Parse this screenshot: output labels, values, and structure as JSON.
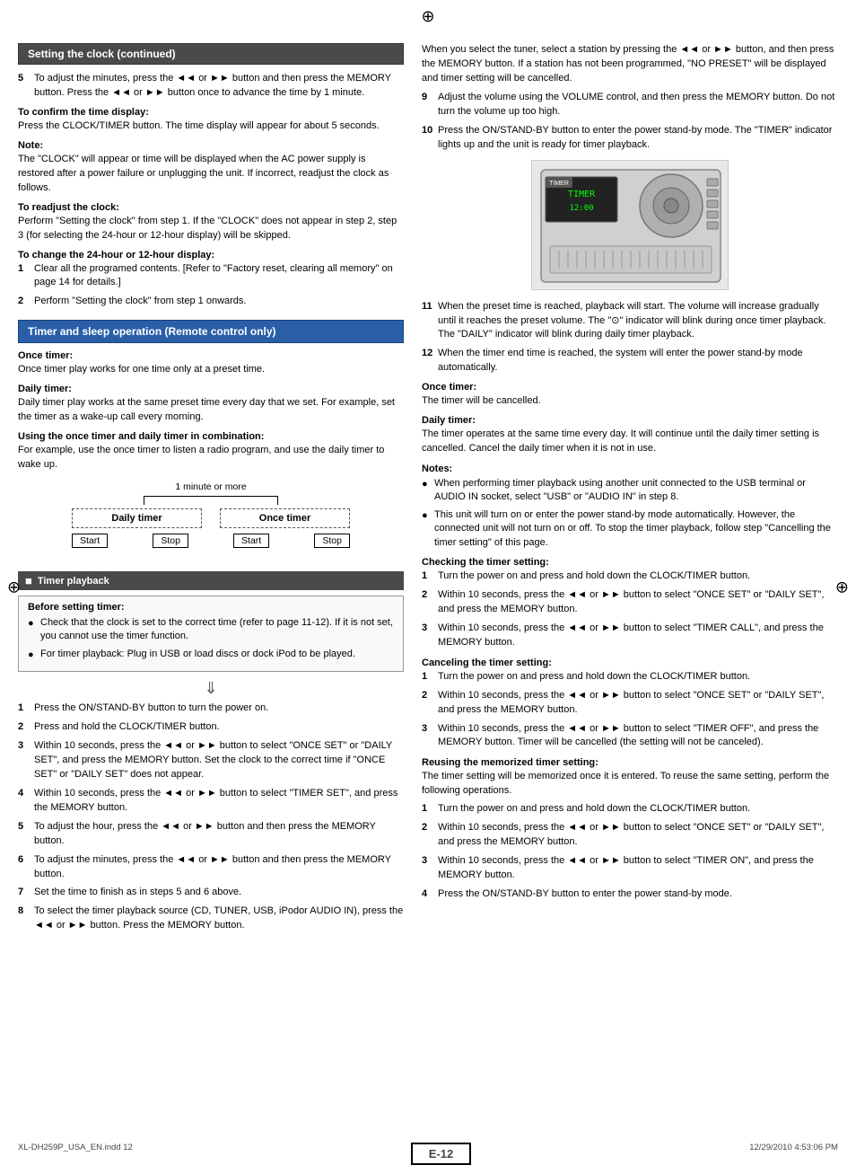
{
  "page": {
    "reg_mark": "⊕",
    "page_number": "E-12",
    "file_info": "XL-DH259P_USA_EN.indd   12",
    "date_info": "12/29/2010   4:53:06 PM"
  },
  "left_column": {
    "section1_title": "Setting the clock (continued)",
    "step5": "To adjust the minutes, press the ◄◄ or ►► button and then press the MEMORY button. Press the ◄◄ or ►► button once to advance the time by 1 minute.",
    "confirm_heading": "To confirm the time display:",
    "confirm_text": "Press the CLOCK/TIMER button. The time display will appear for about 5 seconds.",
    "note_heading": "Note:",
    "note_text": "The \"CLOCK\" will appear or time will be displayed when the AC power supply is restored after a power failure or unplugging the unit. If incorrect, readjust the clock as follows.",
    "readjust_heading": "To readjust the clock:",
    "readjust_text": "Perform \"Setting the clock\" from step 1. If the \"CLOCK\" does not appear in step 2, step 3 (for selecting the 24-hour or 12-hour display) will be skipped.",
    "change24_heading": "To change the 24-hour or 12-hour display:",
    "change24_step1": "Clear all the programed contents. [Refer to \"Factory reset, clearing all memory\" on page 14 for details.]",
    "change24_step2": "Perform \"Setting the clock\" from step 1 onwards.",
    "section2_title": "Timer and sleep operation (Remote control only)",
    "once_timer_heading": "Once timer:",
    "once_timer_text": "Once timer play works for one time only at a preset time.",
    "daily_timer_heading": "Daily timer:",
    "daily_timer_text": "Daily timer play works at the same preset time every day that we set. For example, set the timer as a wake-up call every morning.",
    "combo_heading": "Using the once timer and daily timer in combination:",
    "combo_text": "For example, use the once timer to listen a radio program, and use the daily timer to wake up.",
    "diagram_label_top": "1 minute or more",
    "diagram_daily": "Daily timer",
    "diagram_once": "Once timer",
    "diagram_start1": "Start",
    "diagram_stop1": "Stop",
    "diagram_start2": "Start",
    "diagram_stop2": "Stop",
    "timer_playback_title": "Timer playback",
    "before_title": "Before setting timer:",
    "before_bullet1": "Check that the clock is set to the correct time (refer to page 11-12). If it is not set, you cannot use the timer function.",
    "before_bullet2": "For timer playback: Plug in USB or load discs or dock iPod to be played.",
    "arrow": "⇓",
    "pb_step1": "Press the ON/STAND-BY button to turn the power on.",
    "pb_step2": "Press and hold the CLOCK/TIMER button.",
    "pb_step3": "Within 10 seconds, press the ◄◄ or ►► button to select \"ONCE SET\" or \"DAILY SET\", and press the MEMORY button. Set the clock to the correct time if \"ONCE SET\" or \"DAILY SET\" does not appear.",
    "pb_step4": "Within 10 seconds, press the ◄◄ or ►► button to select \"TIMER SET\", and press the MEMORY button.",
    "pb_step5": "To adjust the hour, press the ◄◄ or ►► button and then press the MEMORY button.",
    "pb_step6": "To adjust the minutes, press the ◄◄ or ►► button and then press the MEMORY button.",
    "pb_step7": "Set the time to finish as in steps 5 and 6 above.",
    "pb_step8": "To select the timer playback source (CD, TUNER, USB, iPodor AUDIO IN), press the ◄◄ or ►► button. Press the MEMORY button."
  },
  "right_column": {
    "step8_text": "When you select the tuner, select a station by pressing the ◄◄ or ►► button, and then press the MEMORY button. If a station has not been programmed, \"NO PRESET\" will be displayed and timer setting will be cancelled.",
    "step9": "Adjust the volume using the VOLUME control, and then press the MEMORY button. Do not turn the volume up too high.",
    "step10": "Press the ON/STAND-BY button to enter the power stand-by mode. The \"TIMER\" indicator lights up and the unit is ready for timer playback.",
    "step11": "When the preset time is reached, playback will start. The volume will increase gradually until it reaches the preset volume. The \"⊙\" indicator will blink during once timer playback. The \"DAILY\" indicator will blink during daily timer playback.",
    "step12": "When the timer end time is reached, the system will enter the power stand-by mode automatically.",
    "once_timer_end_heading": "Once timer:",
    "once_timer_end_text": "The timer will be cancelled.",
    "daily_timer_end_heading": "Daily timer:",
    "daily_timer_end_text": "The timer operates at the same time every day. It will continue until the daily timer setting is cancelled. Cancel the daily timer when it is not in use.",
    "notes_heading": "Notes:",
    "note_bullet1": "When performing timer playback using another unit connected to the USB terminal or AUDIO IN socket, select \"USB\" or \"AUDIO IN\" in step 8.",
    "note_bullet2": "This unit will turn on or enter the power stand-by mode automatically. However, the connected unit will not turn on or off. To stop the timer playback, follow step \"Cancelling the timer setting\" of this page.",
    "checking_heading": "Checking the timer setting:",
    "check_step1": "Turn the power on and press and hold down the CLOCK/TIMER button.",
    "check_step2": "Within 10 seconds, press the ◄◄ or ►► button to select \"ONCE SET\" or \"DAILY SET\", and press the MEMORY button.",
    "check_step3": "Within 10 seconds, press the ◄◄ or ►► button to select \"TIMER CALL\", and press the MEMORY button.",
    "cancelling_heading": "Canceling the timer setting:",
    "cancel_step1": "Turn the power on and press and hold down the CLOCK/TIMER button.",
    "cancel_step2": "Within 10 seconds, press the ◄◄ or ►► button to select \"ONCE SET\" or \"DAILY SET\", and press the MEMORY button.",
    "cancel_step3": "Within 10 seconds, press the ◄◄ or ►► button to select \"TIMER OFF\", and press the MEMORY button. Timer will be cancelled (the setting will not be canceled).",
    "reusing_heading": "Reusing the memorized timer setting:",
    "reusing_text": "The timer setting will be memorized once it is entered. To reuse the same setting, perform the following operations.",
    "reuse_step1": "Turn the power on and press and hold down the CLOCK/TIMER button.",
    "reuse_step2": "Within 10 seconds, press the ◄◄ or ►► button to select \"ONCE SET\" or \"DAILY SET\", and press the MEMORY button.",
    "reuse_step3": "Within 10 seconds, press the ◄◄ or ►► button to select \"TIMER ON\", and press the MEMORY button.",
    "reuse_step4": "Press the ON/STAND-BY button to enter the power stand-by mode."
  }
}
